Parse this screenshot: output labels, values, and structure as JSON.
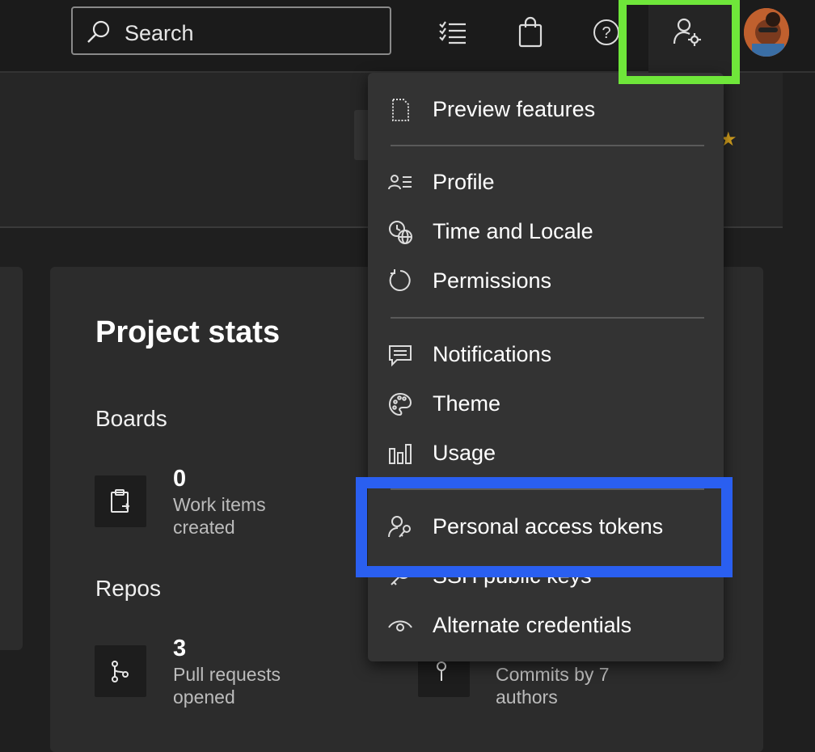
{
  "topbar": {
    "search_placeholder": "Search",
    "icons": [
      "search-icon",
      "checklist-icon",
      "shopping-bag-icon",
      "help-icon",
      "user-settings-icon",
      "avatar"
    ]
  },
  "project_stats": {
    "title": "Project stats",
    "boards": {
      "label": "Boards",
      "count": "0",
      "desc_line1": "Work items",
      "desc_line2": "created"
    },
    "repos": {
      "label": "Repos",
      "prs_count": "3",
      "prs_line1": "Pull requests",
      "prs_line2": "opened",
      "commits_line1": "Commits by 7",
      "commits_line2": "authors"
    }
  },
  "user_menu": {
    "items": [
      {
        "label": "Preview features",
        "icon": "preview-features-icon"
      },
      {
        "label": "Profile",
        "icon": "profile-icon"
      },
      {
        "label": "Time and Locale",
        "icon": "time-locale-icon"
      },
      {
        "label": "Permissions",
        "icon": "permissions-icon"
      },
      {
        "label": "Notifications",
        "icon": "notifications-icon"
      },
      {
        "label": "Theme",
        "icon": "palette-icon"
      },
      {
        "label": "Usage",
        "icon": "usage-chart-icon"
      },
      {
        "label": "Personal access tokens",
        "icon": "personal-access-tokens-icon"
      },
      {
        "label": "SSH public keys",
        "icon": "key-icon"
      },
      {
        "label": "Alternate credentials",
        "icon": "eye-icon"
      }
    ]
  },
  "colors": {
    "background": "#1f1f1f",
    "menu_background": "#333333",
    "highlight_green": "#6fe63a",
    "highlight_blue": "#2a5ff0"
  }
}
